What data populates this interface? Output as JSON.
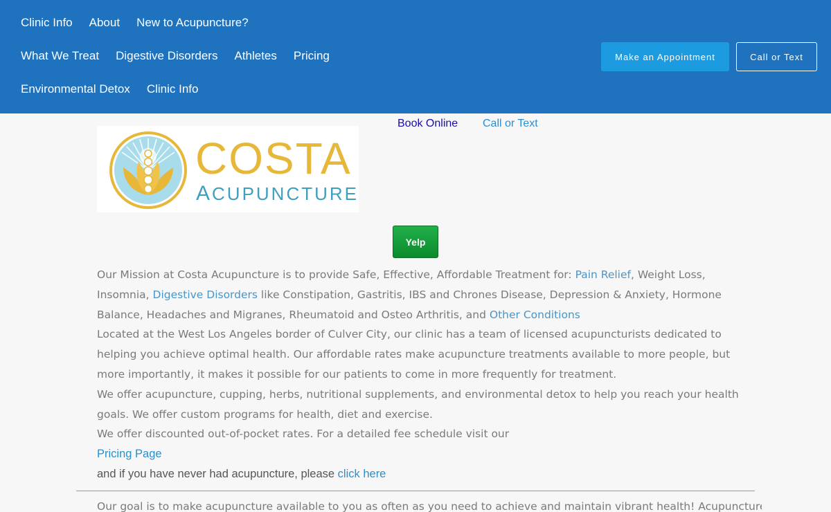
{
  "nav": {
    "row1": [
      "Clinic Info",
      "About",
      "New to Acupuncture?"
    ],
    "row2": [
      "What We Treat",
      "Digestive Disorders",
      "Athletes",
      "Pricing"
    ],
    "row3": [
      "Environmental Detox",
      "Clinic Info"
    ]
  },
  "header_buttons": {
    "appointment": "Make an Appointment",
    "call": "Call or Text"
  },
  "logo": {
    "word1": "COSTA",
    "word2_first": "A",
    "word2_rest": "CUPUNCTURE"
  },
  "top_links": {
    "book": "Book Online",
    "call": "Call or Text"
  },
  "yelp": "Yelp",
  "mission": {
    "intro": "Our Mission at Costa Acupuncture is to provide Safe, Effective, Affordable Treatment for: ",
    "link_pain": "Pain Relief",
    "mid1": ", Weight Loss, Insomnia, ",
    "link_digestive": "Digestive Disorders",
    "mid2": " like Constipation, Gastritis,  IBS and Chrones Disease, Depression & Anxiety, Hormone Balance, Headaches and Migranes, Rheumatoid and Osteo Arthritis, and ",
    "link_other": "Other Conditions"
  },
  "para_location": "Located at the West Los Angeles border of Culver City, our clinic has a team of licensed acupuncturists dedicated to helping you achieve optimal health. Our affordable rates make acupuncture treatments available to more people, but more importantly, it makes it possible for our patients to come in more frequently for treatment.",
  "para_offer": "We offer acupuncture, cupping, herbs, nutritional supplements, and environmental detox to help you reach your health goals. We offer custom programs for health, diet and exercise.",
  "para_discount": "We offer discounted out-of-pocket rates.  For a detailed fee schedule visit our",
  "pricing_link": "Pricing Page",
  "never_had": "and if you have never had acupuncture, please ",
  "click_here": "click here",
  "bottom_text": "Our goal is to make acupuncture available to you as often as you need to achieve and maintain vibrant health!  Acupuncture is most",
  "colors": {
    "header_bg": "#1e72be",
    "appointment_bg": "#1d9be0",
    "logo_gold": "#e7b73a",
    "logo_teal": "#3f9fbd",
    "link_blue": "#4a94c8",
    "yelp_green": "#14a03c"
  }
}
